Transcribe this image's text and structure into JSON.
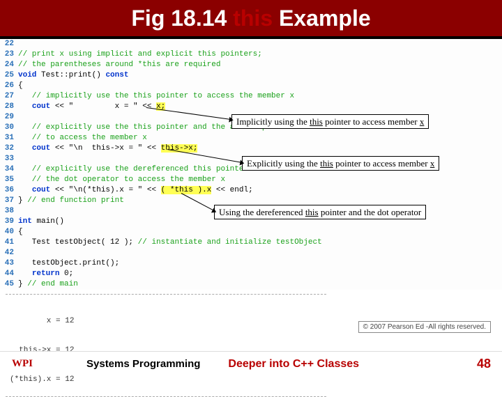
{
  "title": {
    "pre": "Fig 18.14 ",
    "kw": "this",
    "post": " Example"
  },
  "code": [
    {
      "n": 22,
      "comment": "",
      "plain": ""
    },
    {
      "n": 23,
      "comment": "// print x using implicit and explicit this pointers;",
      "plain": ""
    },
    {
      "n": 24,
      "comment": "// the parentheses around *this are required",
      "plain": ""
    },
    {
      "n": 25,
      "kw": "void ",
      "sig": "Test::print() ",
      "kw2": "const",
      "comment": ""
    },
    {
      "n": 26,
      "plain": "{"
    },
    {
      "n": 27,
      "comment": "   // implicitly use the this pointer to access the member x"
    },
    {
      "n": 28,
      "cout": "   ",
      "lit": "\"         x = \"",
      "post": " << ",
      "hl": "x;"
    },
    {
      "n": 29,
      "plain": ""
    },
    {
      "n": 30,
      "comment": "   // explicitly use the this pointer and the arrow operator"
    },
    {
      "n": 31,
      "comment": "   // to access the member x"
    },
    {
      "n": 32,
      "cout": "   ",
      "lit": "\"\\n  this->x = \"",
      "post": " << ",
      "hl": "this->x;"
    },
    {
      "n": 33,
      "plain": ""
    },
    {
      "n": 34,
      "comment": "   // explicitly use the dereferenced this pointer and"
    },
    {
      "n": 35,
      "comment": "   // the dot operator to access the member x"
    },
    {
      "n": 36,
      "cout": "   ",
      "lit": "\"\\n(*this).x = \"",
      "post": " << ",
      "hl": "( *this ).x",
      "tail": " << endl;"
    },
    {
      "n": 37,
      "plain": "} ",
      "comment": "// end function print"
    },
    {
      "n": 38,
      "plain": ""
    },
    {
      "n": 39,
      "kw": "int ",
      "id": "main()"
    },
    {
      "n": 40,
      "plain": "{"
    },
    {
      "n": 41,
      "body": "   Test testObject( 12 ); ",
      "comment": "// instantiate and initialize testObject"
    },
    {
      "n": 42,
      "plain": ""
    },
    {
      "n": 43,
      "body": "   testObject.print();"
    },
    {
      "n": 44,
      "ret": "   ",
      "retkw": "return ",
      "retv": "0;"
    },
    {
      "n": 45,
      "plain": "} ",
      "comment": "// end main"
    }
  ],
  "callouts": {
    "c1": {
      "pre": "Implicitly using the ",
      "kw": "this",
      "post": " pointer to access member ",
      "tail": "x"
    },
    "c2": {
      "pre": "Explicitly using the ",
      "kw": "this",
      "post": " pointer to access member ",
      "tail": "x"
    },
    "c3": {
      "pre": "Using the dereferenced ",
      "kw": "this",
      "post": " pointer and the dot operator",
      "tail": ""
    }
  },
  "output": {
    "l1": "        x = 12",
    "l2": "  this->x = 12",
    "l3": "(*this).x = 12"
  },
  "copyright": "© 2007 Pearson Ed -All rights reserved.",
  "footer": {
    "left": "Systems Programming",
    "mid": "Deeper into C++ Classes",
    "page": "48",
    "logo": "WPI"
  }
}
